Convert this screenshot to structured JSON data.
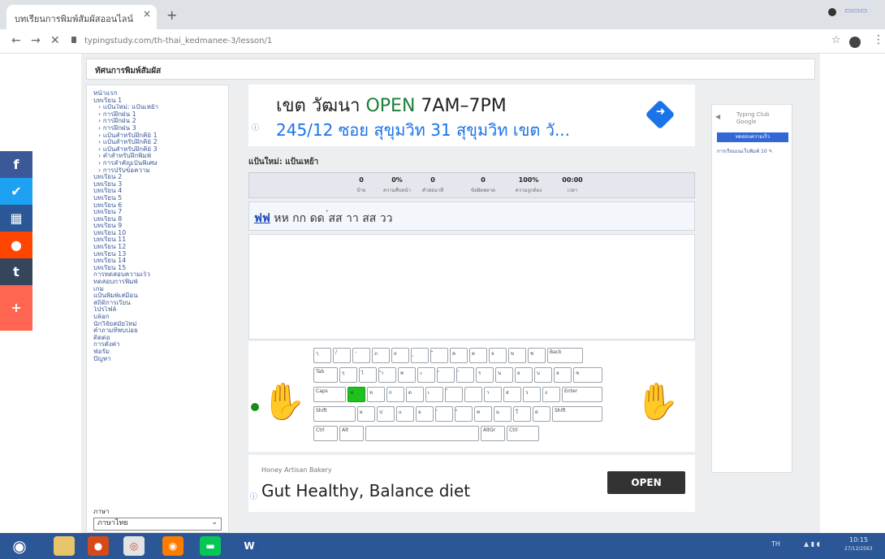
{
  "browser": {
    "tab_title": "บทเรียนการพิมพ์สัมผัสออนไลน์",
    "tab_close": "×",
    "new_tab": "+",
    "url": "typingstudy.com/th-thai_kedmanee-3/lesson/1",
    "back": "←",
    "forward": "→",
    "reload": "✕",
    "star": "☆",
    "menu": "⋮"
  },
  "header": {
    "title": "ทัศนการพิมพ์สัมผัส"
  },
  "sidebar": {
    "items": [
      "หน้าแรก",
      "บทเรียน 1"
    ],
    "subitems": [
      "แป้นใหม่: แป้นเหย้า",
      "การฝึกฝน 1",
      "การฝึกฝน 2",
      "การฝึกฝน 3",
      "แป้นสำหรับฝึกคีย์ 1",
      "แป้นสำหรับฝึกคีย์ 2",
      "แป้นสำหรับฝึกคีย์ 3",
      "คำสำหรับฝึกพิมพ์",
      "การสำคัญเป็นพิเศษ",
      "การปรับข้อความ"
    ],
    "lessons": [
      "บทเรียน 2",
      "บทเรียน 3",
      "บทเรียน 4",
      "บทเรียน 5",
      "บทเรียน 6",
      "บทเรียน 7",
      "บทเรียน 8",
      "บทเรียน 9",
      "บทเรียน 10",
      "บทเรียน 11",
      "บทเรียน 12",
      "บทเรียน 13",
      "บทเรียน 14",
      "บทเรียน 15"
    ],
    "extras": [
      "การทดสอบความเร็ว",
      "ทดสอบการพิมพ์",
      "เกม",
      "แป้นพิมพ์เสมือน",
      "สถิติการเรียน",
      "โปรไฟล์",
      "บล็อก",
      "นักวิจัยสมัยใหม่",
      "คำถามที่พบบ่อย",
      "ติดต่อ",
      "การตั้งค่า",
      "ฟอรัม",
      "ปัญหา"
    ],
    "language_label": "ภาษา",
    "language_value": "ภาษาไทย"
  },
  "social": [
    {
      "glyph": "f",
      "color": "#3b5998",
      "name": "facebook-icon"
    },
    {
      "glyph": "🐦",
      "color": "#1da1f2",
      "name": "twitter-icon"
    },
    {
      "glyph": "▦",
      "color": "#2b5797",
      "name": "grid-icon"
    },
    {
      "glyph": "●",
      "color": "#ff4500",
      "name": "reddit-icon"
    },
    {
      "glyph": "t",
      "color": "#35465c",
      "name": "tumblr-icon"
    },
    {
      "glyph": "+",
      "color": "#ff6550",
      "name": "share-plus-icon"
    }
  ],
  "ad1": {
    "name": "เขต วัฒนา",
    "status": "OPEN",
    "hours": "7AM–7PM",
    "address": "245/12 ซอย สุขุมวิท 31 สุขุมวิท เขต วั...",
    "info": "ⓘ"
  },
  "lesson": {
    "title": "แป้นใหม่: แป้นเหย้า",
    "stats": [
      {
        "value": "0",
        "label": "ป้าย"
      },
      {
        "value": "0%",
        "label": "ความคืบหน้า"
      },
      {
        "value": "0",
        "label": "คำต่อนาที"
      },
      {
        "value": "0",
        "label": "ข้อผิดพลาด"
      },
      {
        "value": "100%",
        "label": "ความถูกต้อง"
      },
      {
        "value": "00:00",
        "label": "เวลา"
      }
    ],
    "drill_current": "ฟฟ",
    "drill_rest": " หห กก ดด ่สส าา สส วว"
  },
  "keyboard": {
    "row1": [
      "ๅ",
      "/",
      "-",
      "ภ",
      "ถ",
      "ุ",
      "ึ",
      "ค",
      "ต",
      "จ",
      "ข",
      "ช",
      "Back"
    ],
    "row2": [
      "Tab",
      "ๆ",
      "ไ",
      "ำ",
      "พ",
      "ะ",
      "ั",
      "ี",
      "ร",
      "น",
      "ย",
      "บ",
      "ล",
      "ฃ"
    ],
    "row3": [
      "Caps",
      "ฟ",
      "ห",
      "ก",
      "ด",
      "เ",
      "้",
      "่",
      "า",
      "ส",
      "ว",
      "ง",
      "Enter"
    ],
    "row4": [
      "Shift",
      "ผ",
      "ป",
      "แ",
      "อ",
      "ิ",
      "ื",
      "ท",
      "ม",
      "ใ",
      "ฝ",
      "Shift"
    ],
    "row5": [
      "Ctrl",
      "Alt",
      "",
      "AltGr",
      "Ctrl"
    ],
    "highlight_color": "#1ec21e"
  },
  "ad2": {
    "advertiser": "Honey Artisan Bakery",
    "headline": "Gut Healthy, Balance diet",
    "button": "OPEN",
    "info": "ⓘ"
  },
  "right_panel": {
    "google_text": "Typing Club\nGoogle",
    "button": "ทดสอบความเร็ว",
    "link": "การเรียนบนเว็บพิมพ์ 10 ✎"
  },
  "taskbar": {
    "time": "10:15",
    "date": "27/12/2563",
    "lang": "TH"
  }
}
